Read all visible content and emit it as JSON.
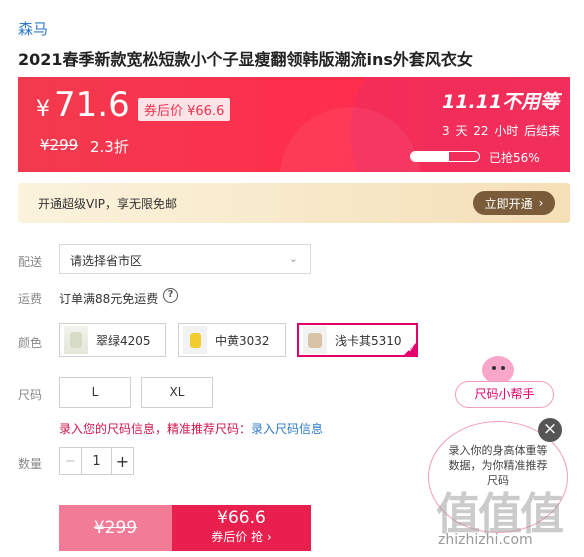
{
  "product": {
    "brand": "森马",
    "title": "2021春季新款宽松短款小个子显瘦翻领韩版潮流ins外套风衣女"
  },
  "price": {
    "currency": "¥",
    "current": "71.6",
    "coupon_price": "券后价 ¥66.6",
    "original": "¥299",
    "discount": "2.3折"
  },
  "promo": {
    "logo": "11.11不用等",
    "countdown": "3 天 22 小时 后结束",
    "sold_fraction": 0.56,
    "sold_label": "已抢56%"
  },
  "vip": {
    "text": "开通超级VIP，享无限免邮",
    "button": "立即开通",
    "button_arrow": "›"
  },
  "delivery": {
    "label": "配送",
    "placeholder": "请选择省市区",
    "chevron": "⌄"
  },
  "shipping": {
    "label": "运费",
    "text": "订单满88元免运费",
    "help": "?"
  },
  "colors": {
    "label": "颜色",
    "options": [
      {
        "label": "翠绿4205",
        "icon": "green-swatch",
        "selected": false
      },
      {
        "label": "中黄3032",
        "icon": "yellow-swatch",
        "selected": false
      },
      {
        "label": "浅卡其5310",
        "icon": "khaki-swatch",
        "selected": true
      }
    ],
    "accent": "#e4006e"
  },
  "sizes": {
    "label": "尺码",
    "options": [
      "L",
      "XL"
    ]
  },
  "size_hint": {
    "text": "录入您的尺码信息，精准推荐尺码：",
    "link": "录入尺码信息"
  },
  "quantity": {
    "label": "数量",
    "minus": "−",
    "value": "1",
    "plus": "+"
  },
  "buy": {
    "original": "¥299",
    "price": "¥66.6",
    "sub": "券后价 抢 ›"
  },
  "size_helper": {
    "button": "尺码小帮手",
    "bubble": "录入你的身高体重等数据，为你精准推荐尺码",
    "close": "×"
  },
  "watermark": {
    "logo": "值值值",
    "url": "zhizhizhi.com"
  },
  "theme": {
    "primary_red": "#ff2d4d",
    "link_blue": "#2f7ac6",
    "vip_brown": "#7a5b3a"
  }
}
